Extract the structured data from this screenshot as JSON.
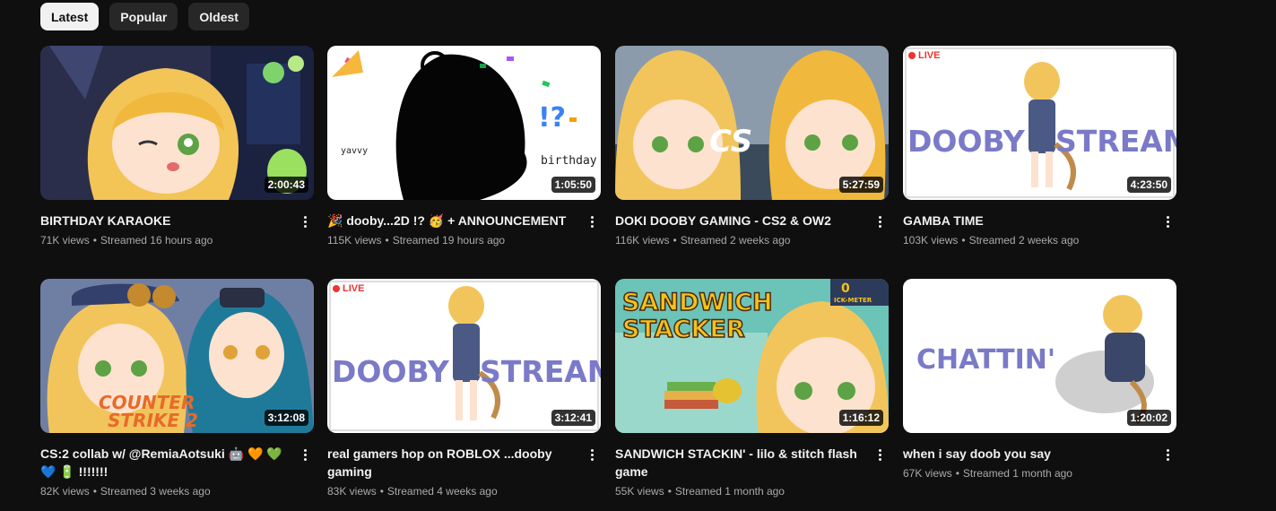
{
  "filters": {
    "latest": "Latest",
    "popular": "Popular",
    "oldest": "Oldest",
    "selected": "Latest"
  },
  "videos": [
    {
      "title": "BIRTHDAY KARAOKE",
      "views": "71K views",
      "age": "Streamed 16 hours ago",
      "duration": "2:00:43"
    },
    {
      "title": "🎉 dooby...2D !? 🥳 + ANNOUNCEMENT",
      "views": "115K views",
      "age": "Streamed 19 hours ago",
      "duration": "1:05:50",
      "thumb_text": [
        "yavvy",
        "birthday",
        "!?"
      ]
    },
    {
      "title": "DOKI DOOBY GAMING - CS2 & OW2",
      "views": "116K views",
      "age": "Streamed 2 weeks ago",
      "duration": "5:27:59",
      "thumb_text": [
        "CS"
      ]
    },
    {
      "title": "GAMBA TIME",
      "views": "103K views",
      "age": "Streamed 2 weeks ago",
      "duration": "4:23:50",
      "live_label": "LIVE",
      "thumb_text": [
        "DOOBY",
        "STREAM"
      ]
    },
    {
      "title": "CS:2 collab w/ @RemiaAotsuki 🤖 🧡 💚 💙 🔋 !!!!!!!",
      "views": "82K views",
      "age": "Streamed 3 weeks ago",
      "duration": "3:12:08",
      "thumb_text": [
        "COUNTER",
        "STRIKE 2"
      ]
    },
    {
      "title": "real gamers hop on ROBLOX ...dooby gaming",
      "views": "83K views",
      "age": "Streamed 4 weeks ago",
      "duration": "3:12:41",
      "live_label": "LIVE",
      "thumb_text": [
        "DOOBY",
        "STREAM"
      ]
    },
    {
      "title": "SANDWICH STACKIN' - lilo & stitch flash game",
      "views": "55K views",
      "age": "Streamed 1 month ago",
      "duration": "1:16:12",
      "thumb_text": [
        "SANDWICH",
        "STACKER",
        "0",
        "ICK-METER"
      ]
    },
    {
      "title": "when i say doob you say",
      "views": "67K views",
      "age": "Streamed 1 month ago",
      "duration": "1:20:02",
      "thumb_text": [
        "CHATTIN'"
      ]
    }
  ],
  "colors": {
    "background": "#0f0f0f",
    "chip": "#272727",
    "chip_active": "#f1f1f1",
    "meta": "#aaaaaa",
    "live": "#e33333"
  }
}
